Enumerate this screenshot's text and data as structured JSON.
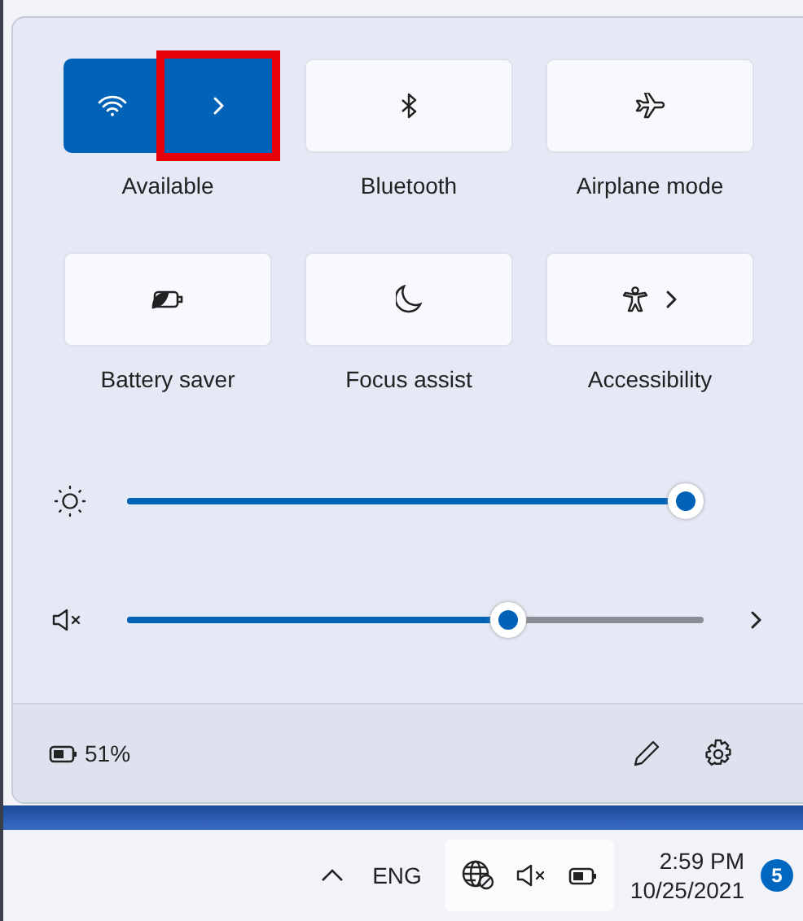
{
  "tiles": [
    {
      "kind": "wifi",
      "label": "Available",
      "on": true,
      "highlighted": true,
      "chevron": true
    },
    {
      "kind": "bluetooth",
      "label": "Bluetooth",
      "on": false,
      "highlighted": false,
      "chevron": false
    },
    {
      "kind": "airplane",
      "label": "Airplane mode",
      "on": false,
      "highlighted": false,
      "chevron": false
    },
    {
      "kind": "battery-saver",
      "label": "Battery saver",
      "on": false,
      "highlighted": false,
      "chevron": false
    },
    {
      "kind": "focus",
      "label": "Focus assist",
      "on": false,
      "highlighted": false,
      "chevron": false
    },
    {
      "kind": "accessibility",
      "label": "Accessibility",
      "on": false,
      "highlighted": false,
      "chevron": true
    }
  ],
  "sliders": [
    {
      "kind": "brightness",
      "level": 0.97,
      "chevron": false
    },
    {
      "kind": "volume",
      "level": 0.66,
      "chevron": true
    }
  ],
  "footer": {
    "battery": "51%"
  },
  "taskbar": {
    "language": "ENG",
    "time": "2:59 PM",
    "date": "10/25/2021",
    "notifications": "5"
  }
}
